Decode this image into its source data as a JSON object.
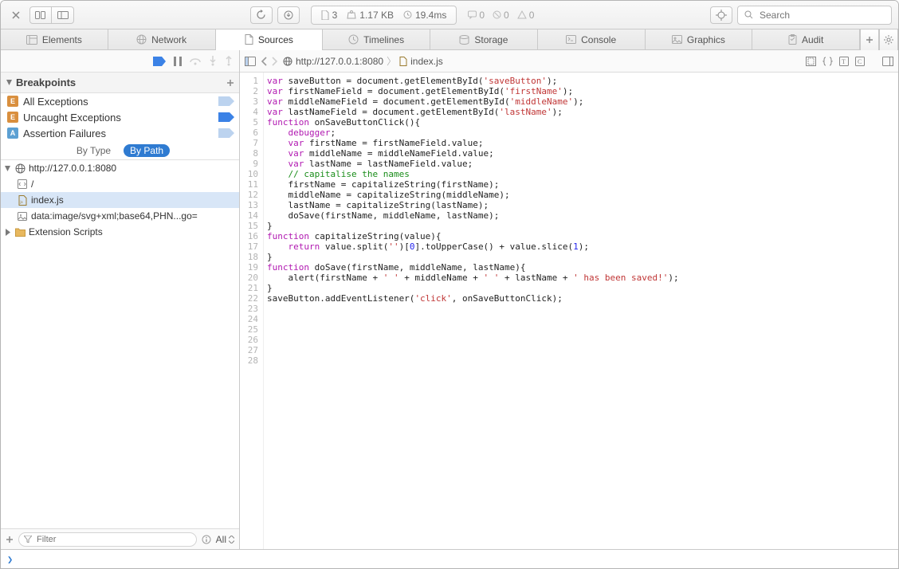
{
  "toolbar": {
    "documents": "3",
    "size": "1.17 KB",
    "time": "19.4ms",
    "msgs": "0",
    "issues": "0",
    "warnings": "0",
    "search_placeholder": "Search"
  },
  "tabs": [
    {
      "label": "Elements"
    },
    {
      "label": "Network"
    },
    {
      "label": "Sources"
    },
    {
      "label": "Timelines"
    },
    {
      "label": "Storage"
    },
    {
      "label": "Console"
    },
    {
      "label": "Graphics"
    },
    {
      "label": "Audit"
    }
  ],
  "breadcrumb": {
    "host": "http://127.0.0.1:8080",
    "file": "index.js"
  },
  "sidebar": {
    "breakpoints_title": "Breakpoints",
    "bp_items": [
      {
        "badge": "E",
        "label": "All Exceptions",
        "active": false
      },
      {
        "badge": "E",
        "label": "Uncaught Exceptions",
        "active": true
      },
      {
        "badge": "A",
        "label": "Assertion Failures",
        "active": false
      }
    ],
    "filter_by_type": "By Type",
    "filter_by_path": "By Path",
    "tree": {
      "origin": "http://127.0.0.1:8080",
      "root_doc": "/",
      "script": "index.js",
      "data_url": "data:image/svg+xml;base64,PHN...go=",
      "ext_folder": "Extension Scripts"
    },
    "footer": {
      "filter_placeholder": "Filter",
      "scope": "All"
    }
  },
  "code": {
    "lines": [
      [
        {
          "t": "var ",
          "c": "kw"
        },
        {
          "t": "saveButton = document.getElementById("
        },
        {
          "t": "'saveButton'",
          "c": "str"
        },
        {
          "t": ");"
        }
      ],
      [
        {
          "t": "var ",
          "c": "kw"
        },
        {
          "t": "firstNameField = document.getElementById("
        },
        {
          "t": "'firstName'",
          "c": "str"
        },
        {
          "t": ");"
        }
      ],
      [
        {
          "t": "var ",
          "c": "kw"
        },
        {
          "t": "middleNameField = document.getElementById("
        },
        {
          "t": "'middleName'",
          "c": "str"
        },
        {
          "t": ");"
        }
      ],
      [
        {
          "t": "var ",
          "c": "kw"
        },
        {
          "t": "lastNameField = document.getElementById("
        },
        {
          "t": "'lastName'",
          "c": "str"
        },
        {
          "t": ");"
        }
      ],
      [
        {
          "t": ""
        }
      ],
      [
        {
          "t": "function ",
          "c": "kw"
        },
        {
          "t": "onSaveButtonClick(){"
        }
      ],
      [
        {
          "t": "    "
        },
        {
          "t": "debugger",
          "c": "kw"
        },
        {
          "t": ";"
        }
      ],
      [
        {
          "t": "    "
        },
        {
          "t": "var ",
          "c": "kw"
        },
        {
          "t": "firstName = firstNameField.value;"
        }
      ],
      [
        {
          "t": "    "
        },
        {
          "t": "var ",
          "c": "kw"
        },
        {
          "t": "middleName = middleNameField.value;"
        }
      ],
      [
        {
          "t": "    "
        },
        {
          "t": "var ",
          "c": "kw"
        },
        {
          "t": "lastName = lastNameField.value;"
        }
      ],
      [
        {
          "t": ""
        }
      ],
      [
        {
          "t": "    "
        },
        {
          "t": "// capitalise the names",
          "c": "cm"
        }
      ],
      [
        {
          "t": "    firstName = capitalizeString(firstName);"
        }
      ],
      [
        {
          "t": "    middleName = capitalizeString(middleName);"
        }
      ],
      [
        {
          "t": "    lastName = capitalizeString(lastName);"
        }
      ],
      [
        {
          "t": ""
        }
      ],
      [
        {
          "t": "    doSave(firstName, middleName, lastName);"
        }
      ],
      [
        {
          "t": "}"
        }
      ],
      [
        {
          "t": ""
        }
      ],
      [
        {
          "t": "function ",
          "c": "kw"
        },
        {
          "t": "capitalizeString(value){"
        }
      ],
      [
        {
          "t": "    "
        },
        {
          "t": "return ",
          "c": "kw"
        },
        {
          "t": "value.split("
        },
        {
          "t": "''",
          "c": "str"
        },
        {
          "t": ")["
        },
        {
          "t": "0",
          "c": "num"
        },
        {
          "t": "].toUpperCase() + value.slice("
        },
        {
          "t": "1",
          "c": "num"
        },
        {
          "t": ");"
        }
      ],
      [
        {
          "t": "}"
        }
      ],
      [
        {
          "t": ""
        }
      ],
      [
        {
          "t": "function ",
          "c": "kw"
        },
        {
          "t": "doSave(firstName, middleName, lastName){"
        }
      ],
      [
        {
          "t": "    alert(firstName + "
        },
        {
          "t": "' '",
          "c": "str"
        },
        {
          "t": " + middleName + "
        },
        {
          "t": "' '",
          "c": "str"
        },
        {
          "t": " + lastName + "
        },
        {
          "t": "' has been saved!'",
          "c": "str"
        },
        {
          "t": ");"
        }
      ],
      [
        {
          "t": "}"
        }
      ],
      [
        {
          "t": ""
        }
      ],
      [
        {
          "t": "saveButton.addEventListener("
        },
        {
          "t": "'click'",
          "c": "str"
        },
        {
          "t": ", onSaveButtonClick);"
        }
      ]
    ]
  },
  "console_prompt": "❯"
}
